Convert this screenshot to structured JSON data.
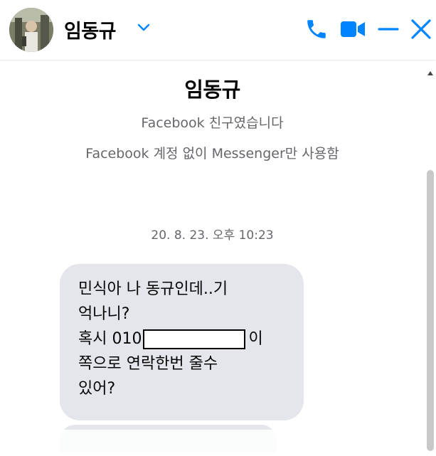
{
  "header": {
    "contact_name": "임동규",
    "icons": [
      "chevron-down-icon",
      "phone-icon",
      "video-camera-icon",
      "minimize-icon",
      "close-icon"
    ],
    "accent_color": "#0084ff"
  },
  "profile": {
    "name": "임동규",
    "relation": "Facebook 친구였습니다",
    "note": "Facebook 계정 없이 Messenger만 사용함"
  },
  "conversation": {
    "timestamp": "20. 8. 23. 오후 10:23",
    "message": {
      "line1": "민식아 나 동규인데..기",
      "line2": "억나니?",
      "line3_prefix": "혹시 010",
      "line3_suffix": "이",
      "line4": "쪽으로 연락한번 줄수",
      "line5": "있어?"
    },
    "bubble_color": "#e4e6eb"
  }
}
